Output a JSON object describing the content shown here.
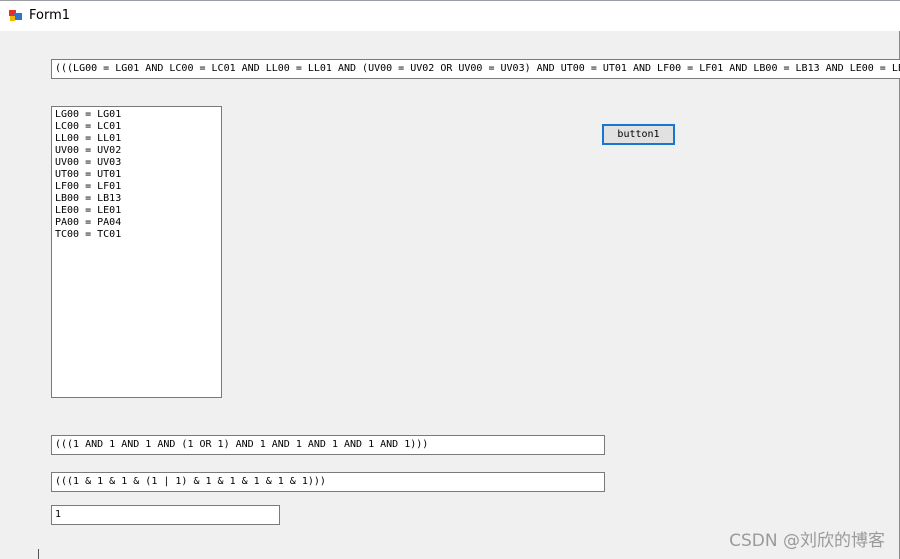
{
  "window": {
    "title": "Form1"
  },
  "top_expression": "(((LG00 = LG01 AND LC00 = LC01 AND LL00 = LL01 AND (UV00 = UV02 OR UV00 = UV03) AND UT00 = UT01 AND LF00 = LF01 AND LB00 = LB13 AND LE00 = LE01",
  "conditions": [
    "LG00 = LG01",
    "LC00 = LC01",
    "LL00 = LL01",
    "UV00 = UV02",
    "UV00 = UV03",
    "UT00 = UT01",
    "LF00 = LF01",
    "LB00 = LB13",
    "LE00 = LE01",
    "PA00 = PA04",
    "TC00 = TC01"
  ],
  "button1_label": "button1",
  "replaced_expression": "(((1 AND 1 AND 1 AND (1 OR 1) AND 1 AND 1 AND 1 AND 1 AND 1)))",
  "symbol_expression": "(((1 & 1 & 1 & (1 | 1) & 1 & 1 & 1 & 1 & 1)))",
  "result": "1",
  "watermark": "CSDN @刘欣的博客"
}
